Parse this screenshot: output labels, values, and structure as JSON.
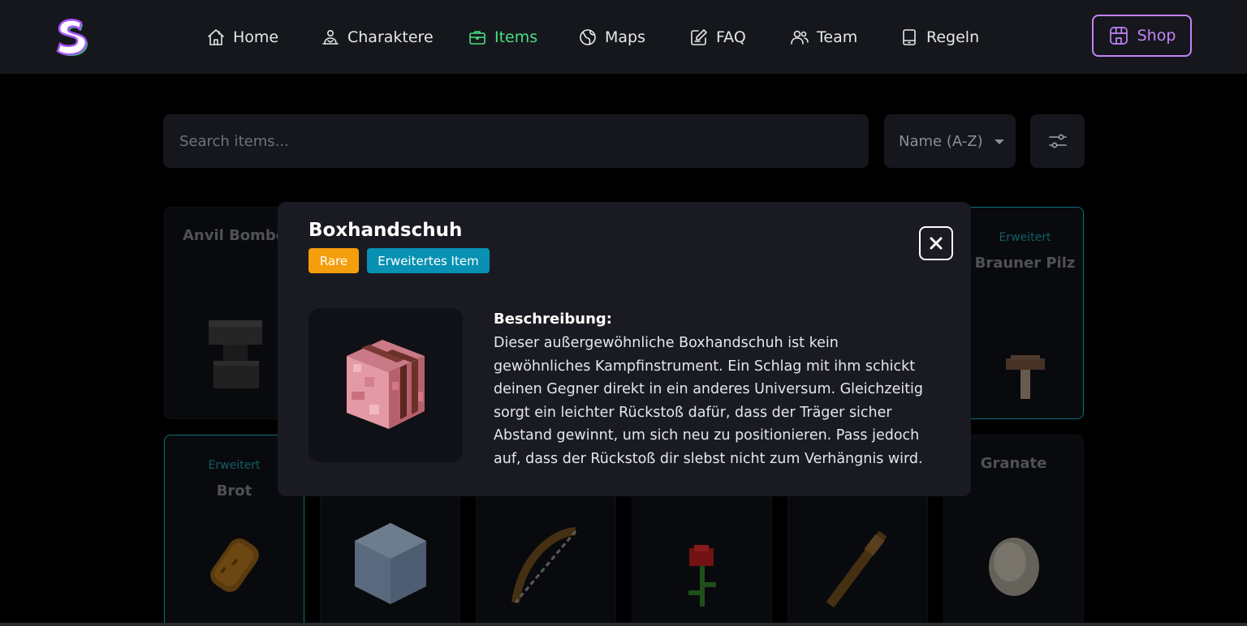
{
  "nav": {
    "items": [
      {
        "label": "Home",
        "icon": "home-icon",
        "active": false
      },
      {
        "label": "Charaktere",
        "icon": "character-icon",
        "active": false
      },
      {
        "label": "Items",
        "icon": "briefcase-icon",
        "active": true
      },
      {
        "label": "Maps",
        "icon": "globe-icon",
        "active": false
      },
      {
        "label": "FAQ",
        "icon": "faq-edit-icon",
        "active": false
      },
      {
        "label": "Team",
        "icon": "team-icon",
        "active": false
      },
      {
        "label": "Regeln",
        "icon": "tablet-icon",
        "active": false
      }
    ],
    "shop_label": "Shop"
  },
  "toolbar": {
    "search_placeholder": "Search items...",
    "sort_label": "Name (A-Z)"
  },
  "items": [
    {
      "name": "Anvil Bombe",
      "tag": ""
    },
    {
      "name": "Brauner Pilz",
      "tag": "Erweitert"
    },
    {
      "name": "Brot",
      "tag": "Erweitert"
    },
    {
      "name": "Granate",
      "tag": ""
    }
  ],
  "modal": {
    "title": "Boxhandschuh",
    "rarity_badge": "Rare",
    "type_badge": "Erweitertes Item",
    "description_label": "Beschreibung:",
    "description": "Dieser außergewöhnliche Boxhandschuh ist kein gewöhnliches Kampfinstrument. Ein Schlag mit ihm schickt deinen Gegner direkt in ein anderes Universum. Gleichzeitig sorgt ein leichter Rückstoß dafür, dass der Träger sicher Abstand gewinnt, um sich neu zu positionieren. Pass jedoch auf, dass der Rückstoß dir slebst nicht zum Verhängnis wird."
  },
  "colors": {
    "accent_active": "#4ade80",
    "shop": "#c084fc",
    "rare": "#f59e0b",
    "extended": "#0891b2"
  }
}
